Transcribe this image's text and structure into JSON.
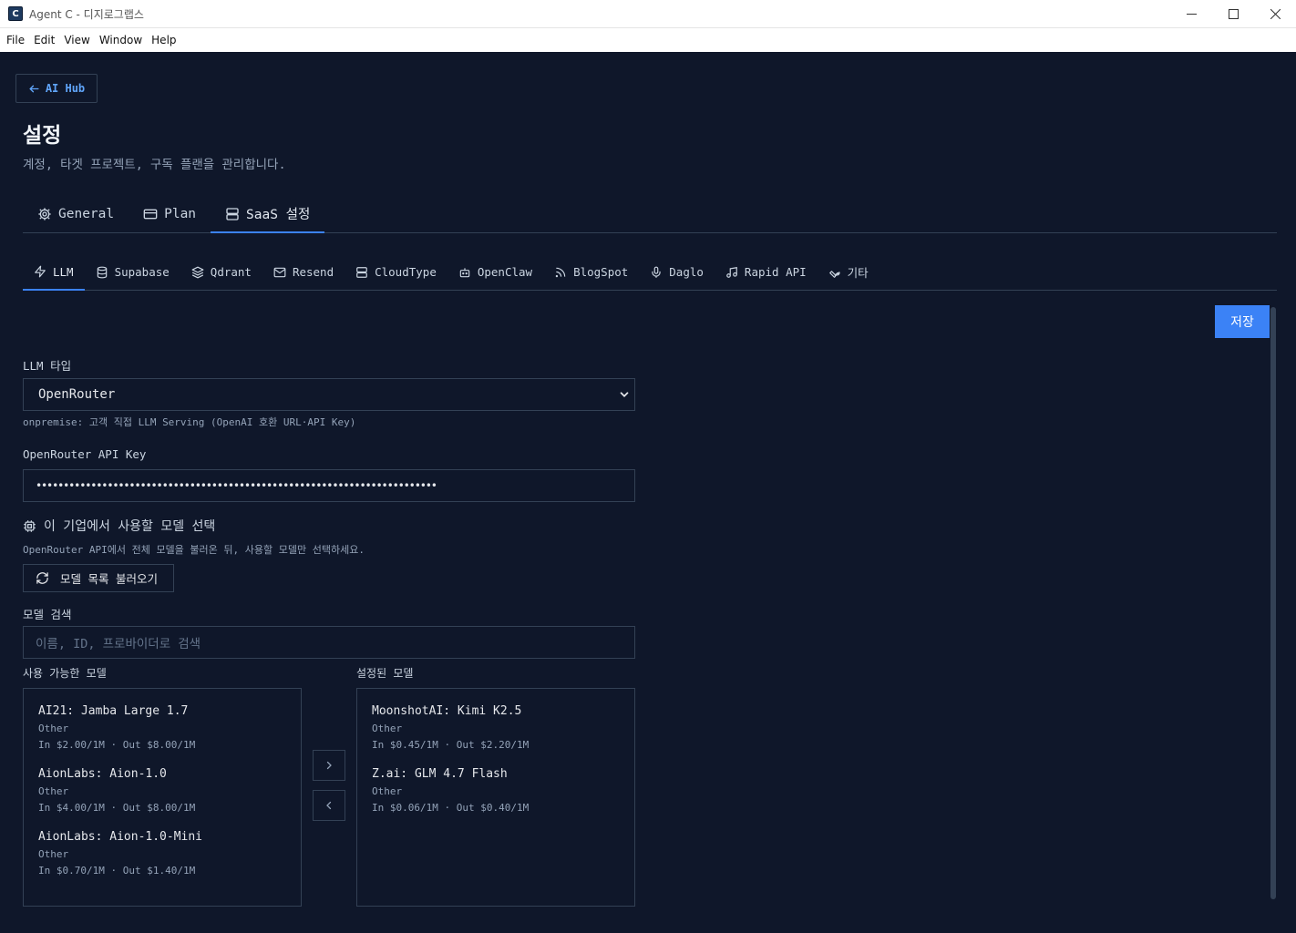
{
  "window": {
    "title": "Agent C - 디지로그랩스"
  },
  "menu": [
    "File",
    "Edit",
    "View",
    "Window",
    "Help"
  ],
  "back_button": {
    "label": "AI Hub",
    "icon": "arrow-left-icon"
  },
  "page": {
    "title": "설정",
    "subtitle": "계정, 타겟 프로젝트, 구독 플랜을 관리합니다."
  },
  "main_tabs": [
    {
      "label": "General",
      "icon": "gear-icon"
    },
    {
      "label": "Plan",
      "icon": "card-icon"
    },
    {
      "label": "SaaS 설정",
      "icon": "server-icon",
      "active": true
    }
  ],
  "sub_tabs": [
    {
      "label": "LLM",
      "icon": "lightning-icon",
      "active": true
    },
    {
      "label": "Supabase",
      "icon": "database-icon"
    },
    {
      "label": "Qdrant",
      "icon": "layers-icon"
    },
    {
      "label": "Resend",
      "icon": "mail-icon"
    },
    {
      "label": "CloudType",
      "icon": "server-icon"
    },
    {
      "label": "OpenClaw",
      "icon": "bot-icon"
    },
    {
      "label": "BlogSpot",
      "icon": "rss-icon"
    },
    {
      "label": "Daglo",
      "icon": "mic-icon"
    },
    {
      "label": "Rapid API",
      "icon": "music-icon"
    },
    {
      "label": "기타",
      "icon": "wrench-icon"
    }
  ],
  "save_button": "저장",
  "llm": {
    "type_label": "LLM 타입",
    "type_value": "OpenRouter",
    "type_hint": "onpremise: 고객 직접 LLM Serving (OpenAI 호환 URL·API Key)",
    "api_key_label": "OpenRouter API Key",
    "api_key_value": "•••••••••••••••••••••••••••••••••••••••••••••••••••••••••••••••••••••••••",
    "models_heading": "이 기업에서 사용할 모델 선택",
    "models_hint": "OpenRouter API에서 전체 모델을 불러온 뒤, 사용할 모델만 선택하세요.",
    "load_button": "모델 목록 불러오기",
    "search_label": "모델 검색",
    "search_placeholder": "이름, ID, 프로바이더로 검색",
    "available_label": "사용 가능한 모델",
    "selected_label": "설정된 모델",
    "available": [
      {
        "name": "AI21: Jamba Large 1.7",
        "provider": "Other",
        "price": "In $2.00/1M · Out $8.00/1M"
      },
      {
        "name": "AionLabs: Aion-1.0",
        "provider": "Other",
        "price": "In $4.00/1M · Out $8.00/1M"
      },
      {
        "name": "AionLabs: Aion-1.0-Mini",
        "provider": "Other",
        "price": "In $0.70/1M · Out $1.40/1M"
      }
    ],
    "selected": [
      {
        "name": "MoonshotAI: Kimi K2.5",
        "provider": "Other",
        "price": "In $0.45/1M · Out $2.20/1M"
      },
      {
        "name": "Z.ai: GLM 4.7 Flash",
        "provider": "Other",
        "price": "In $0.06/1M · Out $0.40/1M"
      }
    ]
  },
  "colors": {
    "accent": "#3b82f6",
    "background": "#0f172a",
    "border": "#334155"
  }
}
